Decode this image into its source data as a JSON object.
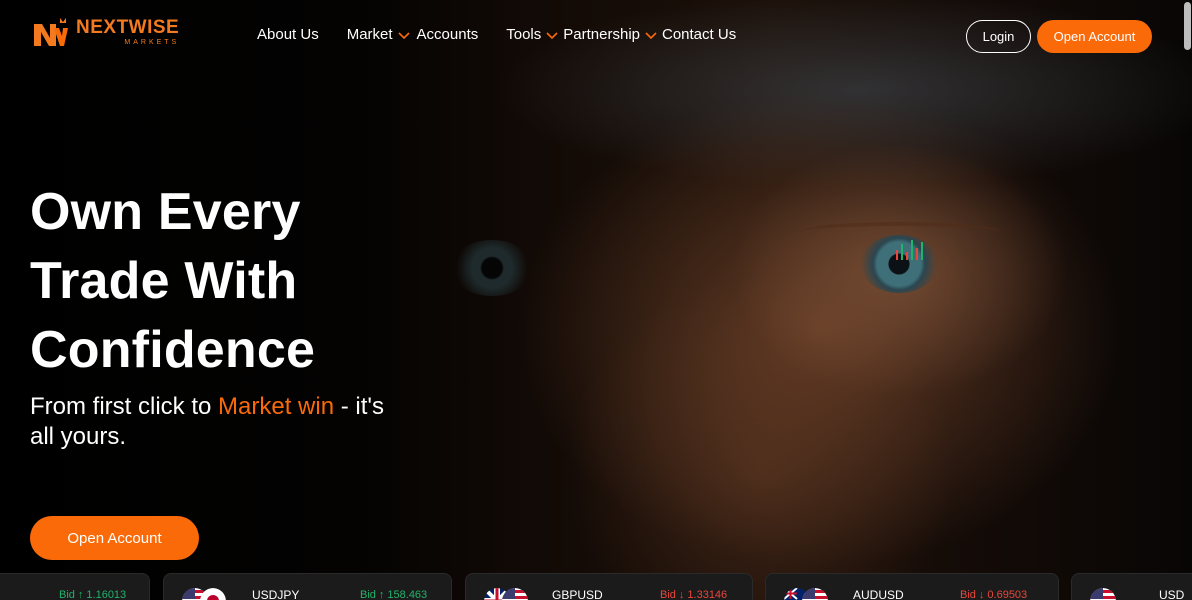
{
  "brand": {
    "name": "NEXTWISE",
    "sub": "MARKETS",
    "color": "#f47a1f"
  },
  "nav": {
    "about": "About Us",
    "market": "Market",
    "accounts": "Accounts",
    "tools": "Tools",
    "partnership": "Partnership",
    "contact": "Contact Us"
  },
  "header": {
    "login": "Login",
    "open_account": "Open Account"
  },
  "hero": {
    "headline": "Own Every Trade With Confidence",
    "sub_before": "From first click to ",
    "sub_accent": "Market win",
    "sub_after": " - it's all yours.",
    "cta": "Open Account"
  },
  "ticker": [
    {
      "pair": "",
      "bid_label": "Bid",
      "direction": "up",
      "value": "1.16013"
    },
    {
      "pair": "USDJPY",
      "bid_label": "Bid",
      "direction": "up",
      "value": "158.463"
    },
    {
      "pair": "GBPUSD",
      "bid_label": "Bid",
      "direction": "down",
      "value": "1.33146"
    },
    {
      "pair": "AUDUSD",
      "bid_label": "Bid",
      "direction": "down",
      "value": "0.69503"
    },
    {
      "pair": "USD",
      "bid_label": "",
      "direction": "",
      "value": ""
    }
  ],
  "colors": {
    "accent": "#fb6a09",
    "up": "#22b26a",
    "down": "#e8473b"
  },
  "icons": {
    "chevron": "chevron-down-icon",
    "arrow_up": "arrow-up-icon",
    "arrow_down": "arrow-down-icon"
  }
}
